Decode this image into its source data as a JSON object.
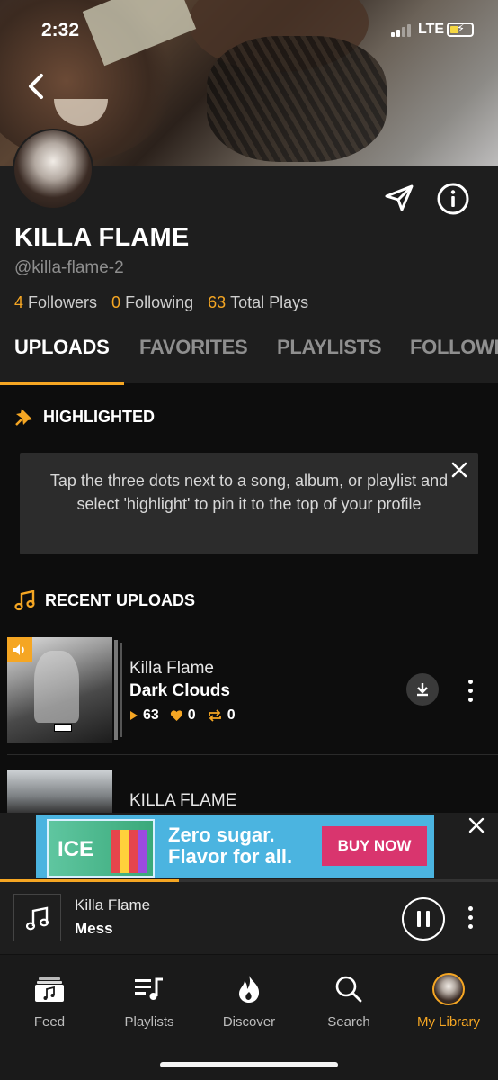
{
  "status_bar": {
    "time": "2:32",
    "network": "LTE"
  },
  "profile": {
    "name": "KILLA FLAME",
    "handle": "@killa-flame-2",
    "stats": [
      {
        "count": "4",
        "label": "Followers"
      },
      {
        "count": "0",
        "label": "Following"
      },
      {
        "count": "63",
        "label": "Total Plays"
      }
    ]
  },
  "tabs": [
    {
      "label": "UPLOADS",
      "active": true
    },
    {
      "label": "FAVORITES",
      "active": false
    },
    {
      "label": "PLAYLISTS",
      "active": false
    },
    {
      "label": "FOLLOWI",
      "active": false
    }
  ],
  "highlighted": {
    "heading": "HIGHLIGHTED",
    "tip": "Tap the three dots next to a song, album, or playlist and select 'highlight' to pin it to the top of your profile"
  },
  "recent_uploads": {
    "heading": "RECENT UPLOADS",
    "tracks": [
      {
        "artist": "Killa Flame",
        "title": "Dark Clouds",
        "plays": "63",
        "likes": "0",
        "reposts": "0"
      },
      {
        "artist": "KILLA FLAME",
        "title": "",
        "plays": "",
        "likes": "",
        "reposts": ""
      }
    ]
  },
  "ad": {
    "brand_text": "ICE",
    "headline_line1": "Zero sugar.",
    "headline_line2": "Flavor for all.",
    "cta": "BUY NOW"
  },
  "now_playing": {
    "artist": "Killa Flame",
    "title": "Mess",
    "progress": 0.36
  },
  "bottom_nav": [
    {
      "label": "Feed",
      "icon": "feed-icon",
      "active": false
    },
    {
      "label": "Playlists",
      "icon": "playlists-icon",
      "active": false
    },
    {
      "label": "Discover",
      "icon": "flame-icon",
      "active": false
    },
    {
      "label": "Search",
      "icon": "search-icon",
      "active": false
    },
    {
      "label": "My Library",
      "icon": "library-avatar-icon",
      "active": true
    }
  ],
  "colors": {
    "accent": "#f5a623",
    "background": "#0d0d0d",
    "panel": "#1e1e1e",
    "ad_blue": "#4bb4e0",
    "ad_cta": "#d9356e"
  }
}
